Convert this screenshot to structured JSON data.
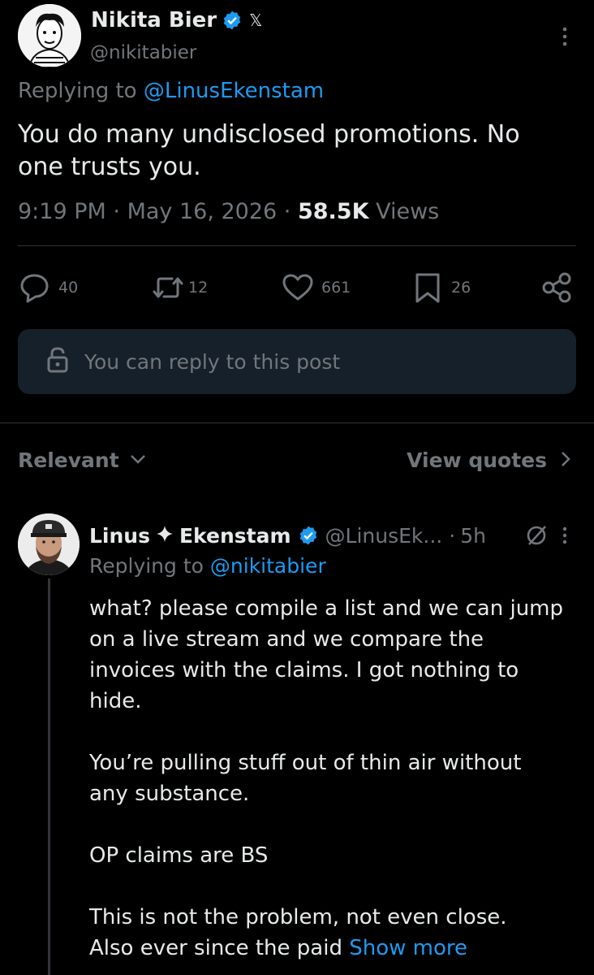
{
  "main_post": {
    "author_name": "Nikita Bier",
    "author_handle": "@nikitabier",
    "replying_prefix": "Replying to",
    "replying_to": "@LinusEkenstam",
    "text": "You do many undisclosed promotions. No one trusts you.",
    "time": "9:19 PM",
    "date": "May 16, 2026",
    "views_count": "58.5K",
    "views_label": "Views",
    "icons": {
      "verified": "verified-badge-icon",
      "affiliate": "x-logo-icon",
      "more": "more-vertical-icon"
    }
  },
  "actions": {
    "replies": "40",
    "reposts": "12",
    "likes": "661",
    "bookmarks": "26"
  },
  "reply_box": {
    "text": "You can reply to this post"
  },
  "sort": {
    "relevant": "Relevant",
    "view_quotes": "View quotes"
  },
  "reply": {
    "name_first": "Linus",
    "name_last": "Ekenstam",
    "handle": "@LinusEk...",
    "separator": "·",
    "time": "5h",
    "replying_prefix": "Replying to",
    "replying_to": "@nikitabier",
    "paragraph1_lines": [
      "what? please compile a list and we can jump",
      "on a live stream and we compare the",
      "invoices with the claims. I got nothing to",
      "hide."
    ],
    "paragraph2_lines": [
      "You’re pulling stuff out of thin air without",
      "any substance."
    ],
    "paragraph3": "OP claims are BS",
    "paragraph4_line1": "This is not the problem, not even close.",
    "paragraph4_line2": "Also ever since the paid",
    "show_more": "Show more"
  },
  "colors": {
    "background": "#000000",
    "text": "#e7e9ea",
    "muted": "#71767b",
    "accent": "#1d9bf0",
    "reply_box_bg": "#16202a"
  }
}
